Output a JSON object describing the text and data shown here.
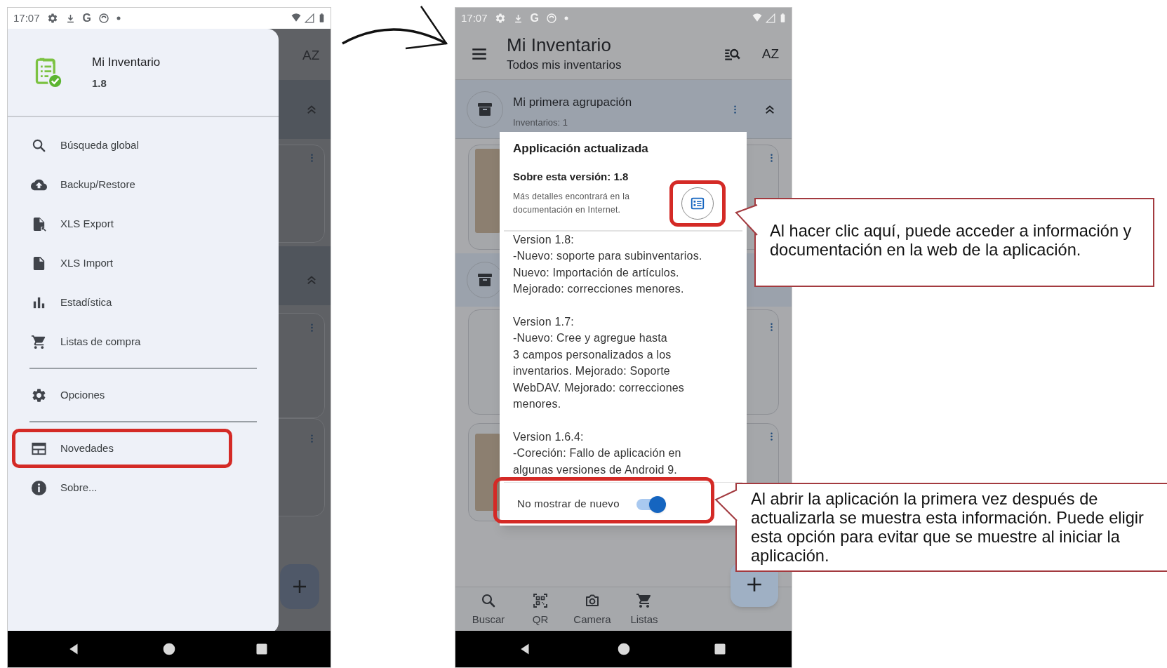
{
  "left_phone": {
    "status_bar": {
      "time": "17:07",
      "g_label": "G"
    },
    "background": {
      "sort_label": "AZ"
    },
    "drawer": {
      "app_name": "Mi Inventario",
      "version": "1.8",
      "sections": [
        {
          "items": [
            {
              "label": "Búsqueda global",
              "kind": "search",
              "annotated": false
            },
            {
              "label": "Backup/Restore",
              "kind": "cloud",
              "annotated": false
            },
            {
              "label": "XLS Export",
              "kind": "export",
              "annotated": false
            },
            {
              "label": "XLS Import",
              "kind": "file",
              "annotated": false
            },
            {
              "label": "Estadística",
              "kind": "chart",
              "annotated": false
            },
            {
              "label": "Listas de compra",
              "kind": "cart",
              "annotated": false
            }
          ]
        },
        {
          "items": [
            {
              "label": "Opciones",
              "kind": "settings",
              "annotated": false
            }
          ]
        },
        {
          "items": [
            {
              "label": "Novedades",
              "kind": "news",
              "annotated": true
            },
            {
              "label": "Sobre...",
              "kind": "info",
              "annotated": false
            }
          ]
        }
      ]
    }
  },
  "right_phone": {
    "status_bar": {
      "time": "17:07",
      "g_label": "G"
    },
    "app_bar": {
      "title": "Mi Inventario",
      "subtitle": "Todos mis inventarios",
      "sort_label": "AZ"
    },
    "group": {
      "name": "Mi primera agrupación",
      "count": "Inventarios: 1"
    },
    "dialog": {
      "title": "Applicación actualizada",
      "subtitle": "Sobre esta versión: 1.8",
      "note": "Más detalles encontrará en la documentación en Internet.",
      "info_button": {
        "annotated": true
      },
      "changelog": [
        {
          "lines": [
            "Version 1.8:",
            "-Nuevo: soporte para subinventarios.",
            "Nuevo: Importación de artículos.",
            "Mejorado: correcciones menores."
          ]
        },
        {
          "lines": [
            "Version 1.7:",
            "-Nuevo: Cree y agregue hasta",
            "3 campos personalizados a los",
            "inventarios. Mejorado: Soporte",
            "WebDAV. Mejorado: correcciones",
            "menores."
          ]
        },
        {
          "lines": [
            "Version 1.6.4:",
            "-Coreción: Fallo de aplicación en",
            "algunas versiones de Android 9."
          ]
        }
      ],
      "toggle": {
        "label": "No mostrar de nuevo",
        "on": true,
        "annotated": true
      }
    },
    "bottom_nav": [
      {
        "label": "Buscar",
        "kind": "search"
      },
      {
        "label": "QR",
        "kind": "qr"
      },
      {
        "label": "Camera",
        "kind": "camera"
      },
      {
        "label": "Listas",
        "kind": "cart"
      }
    ]
  },
  "callouts": [
    "Al hacer clic aquí, puede acceder a información y documentación en la web de la aplicación.",
    "Al abrir la aplicación la primera vez después de actualizarla se muestra esta información. Puede eligir esta opción para evitar que se muestre al iniciar la aplicación."
  ]
}
